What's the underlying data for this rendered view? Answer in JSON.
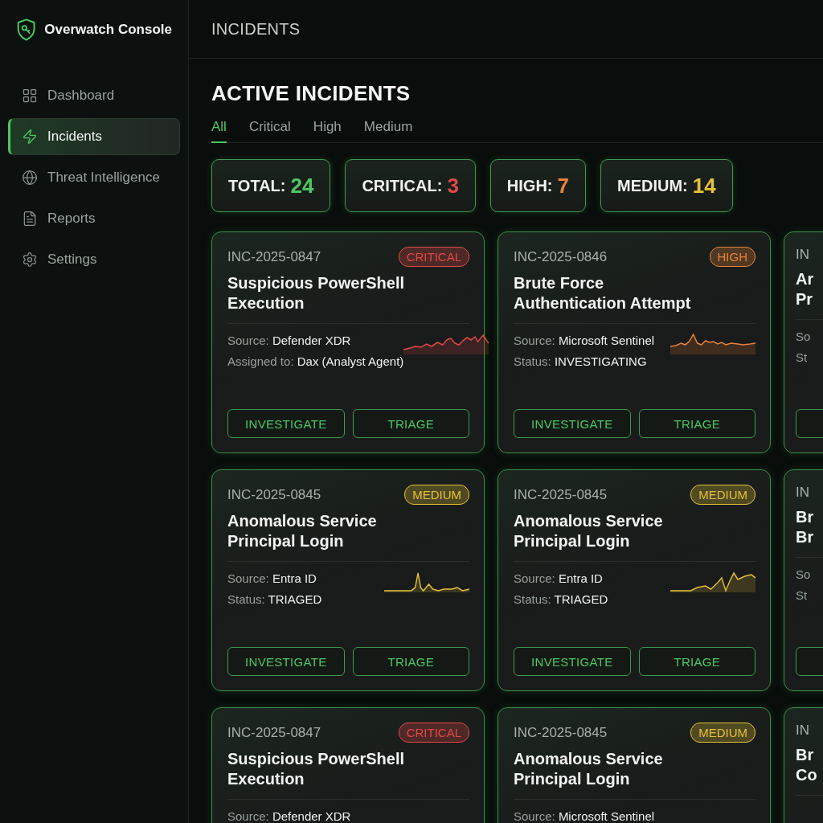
{
  "sidebar": {
    "brand": "Overwatch Console",
    "items": [
      {
        "label": "Dashboard",
        "selected": false
      },
      {
        "label": "Incidents",
        "selected": true
      },
      {
        "label": "Threat Intelligence",
        "selected": false
      },
      {
        "label": "Reports",
        "selected": false
      },
      {
        "label": "Settings",
        "selected": false
      }
    ]
  },
  "header": {
    "title": "INCIDENTS"
  },
  "section": {
    "title": "ACTIVE INCIDENTS"
  },
  "tabs": [
    {
      "label": "All",
      "selected": true
    },
    {
      "label": "Critical",
      "selected": false
    },
    {
      "label": "High",
      "selected": false
    },
    {
      "label": "Medium",
      "selected": false
    }
  ],
  "stats": [
    {
      "label": "TOTAL:",
      "value": "24",
      "color": "#4cc764"
    },
    {
      "label": "CRITICAL:",
      "value": "3",
      "color": "#e04848"
    },
    {
      "label": "HIGH:",
      "value": "7",
      "color": "#e8823a"
    },
    {
      "label": "MEDIUM:",
      "value": "14",
      "color": "#e6c23a"
    }
  ],
  "incidents": [
    {
      "kind": "full",
      "id": "INC-2025-0847",
      "badge": {
        "label": "CRITICAL",
        "color": "#e04848"
      },
      "title_lines": [
        "Suspicious PowerShell",
        "Execution"
      ],
      "fields": [
        {
          "label": "Source:",
          "value": "Defender XDR"
        },
        {
          "label": "Assigned to:",
          "value": "Dax (Analyst Agent)"
        }
      ],
      "actions": [
        "INVESTIGATE",
        "TRIAGE"
      ]
    },
    {
      "kind": "full",
      "id": "INC-2025-0846",
      "badge": {
        "label": "HIGH",
        "color": "#e8823a"
      },
      "title_lines": [
        "Brute Force",
        "Authentication Attempt"
      ],
      "fields": [
        {
          "label": "Source:",
          "value": "Microsoft Sentinel"
        },
        {
          "label": "Status:",
          "value": "INVESTIGATING"
        }
      ],
      "actions": [
        "INVESTIGATE",
        "TRIAGE"
      ]
    },
    {
      "kind": "clipped",
      "id": "IN",
      "title_lines": [
        "Ar",
        "Pr"
      ],
      "fields": [
        {
          "label": "So"
        },
        {
          "label": "St"
        }
      ]
    },
    {
      "kind": "full",
      "id": "INC-2025-0845",
      "badge": {
        "label": "MEDIUM",
        "color": "#e6c23a"
      },
      "title_lines": [
        "Anomalous Service",
        "Principal Login"
      ],
      "fields": [
        {
          "label": "Source:",
          "value": "Entra ID"
        },
        {
          "label": "Status:",
          "value": "TRIAGED"
        }
      ],
      "actions": [
        "INVESTIGATE",
        "TRIAGE"
      ]
    },
    {
      "kind": "full",
      "id": "INC-2025-0845",
      "badge": {
        "label": "MEDIUM",
        "color": "#e6c23a"
      },
      "title_lines": [
        "Anomalous Service",
        "Principal Login"
      ],
      "fields": [
        {
          "label": "Source:",
          "value": "Entra ID"
        },
        {
          "label": "Status:",
          "value": "TRIAGED"
        }
      ],
      "actions": [
        "INVESTIGATE",
        "TRIAGE"
      ]
    },
    {
      "kind": "clipped",
      "id": "IN",
      "title_lines": [
        "Br",
        "Br"
      ],
      "fields": [
        {
          "label": "So"
        },
        {
          "label": "St"
        }
      ]
    },
    {
      "kind": "full",
      "id": "INC-2025-0847",
      "badge": {
        "label": "CRITICAL",
        "color": "#e04848"
      },
      "title_lines": [
        "Suspicious PowerShell",
        "Execution"
      ],
      "fields": [
        {
          "label": "Source:",
          "value": "Defender XDR"
        }
      ]
    },
    {
      "kind": "full",
      "id": "INC-2025-0845",
      "badge": {
        "label": "MEDIUM",
        "color": "#e6c23a"
      },
      "title_lines": [
        "Anomalous Service",
        "Principal Login"
      ],
      "fields": [
        {
          "label": "Source:",
          "value": "Microsoft Sentinel"
        }
      ]
    },
    {
      "kind": "clipped",
      "id": "IN",
      "title_lines": [
        "Br",
        "Co"
      ]
    }
  ]
}
